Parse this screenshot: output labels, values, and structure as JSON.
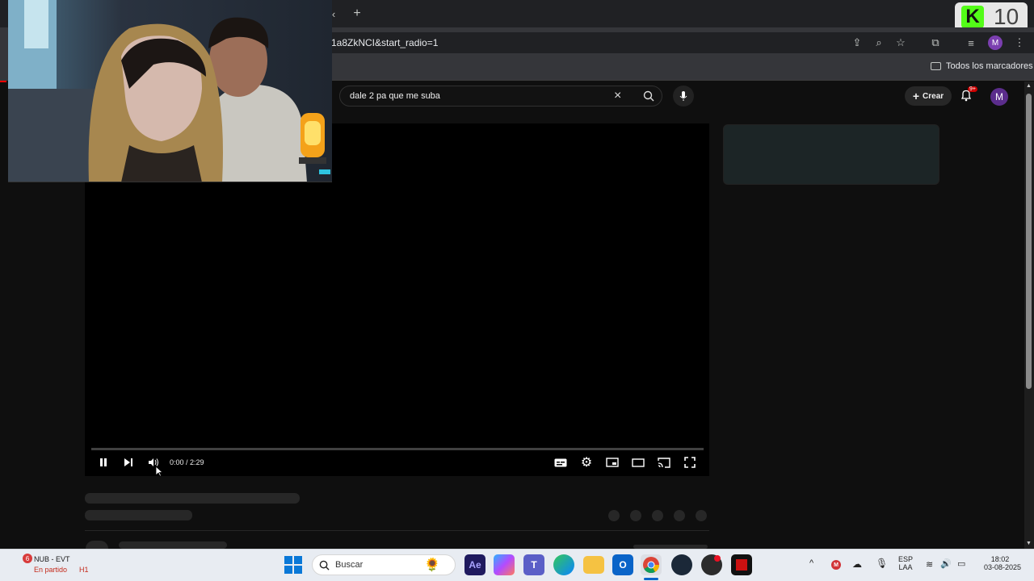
{
  "browser": {
    "url": "1a8ZkNCI&start_radio=1",
    "new_tab": "+",
    "bookmarks_folder": "Todos los marcadores"
  },
  "overlay": {
    "counter": "10",
    "logo_letter": "K"
  },
  "youtube": {
    "search_value": "dale 2 pa que me suba",
    "create_label": "Crear",
    "notif_badge": "9+",
    "avatar_letter": "M",
    "time_display": "0:00 / 2:29",
    "progress_fraction": 0.0
  },
  "taskbar": {
    "match_badge": "6",
    "match_title": "NUB - EVT",
    "match_status": "En partido",
    "match_half": "H1",
    "search_placeholder": "Buscar",
    "lang_line1": "ESP",
    "lang_line2": "LAA",
    "clock_time": "18:02",
    "clock_date": "03-08-2025"
  },
  "colors": {
    "accent_red": "#ff0000",
    "taskbar_bg": "#e8ecf2",
    "chrome_bg": "#35363a"
  }
}
